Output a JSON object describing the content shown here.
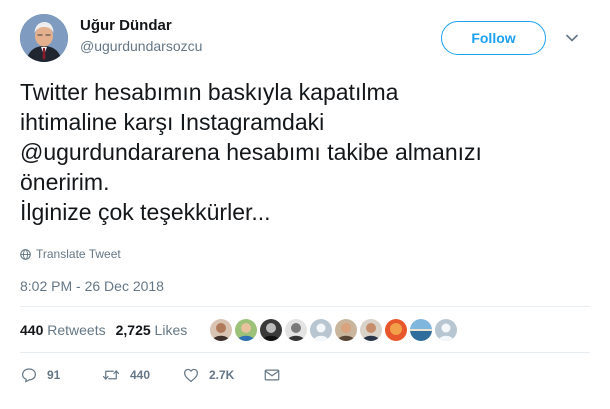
{
  "author": {
    "name": "Uğur Dündar",
    "handle": "@ugurdundarsozcu",
    "follow_label": "Follow"
  },
  "tweet": {
    "lines": [
      "Twitter hesabımın baskıyla kapatılma",
      "ihtimaline karşı Instagramdaki",
      "@ugurdundararena hesabımı takibe almanızı",
      "öneririm.",
      "İlginize çok teşekkürler..."
    ],
    "translate_label": "Translate Tweet",
    "timestamp": "8:02 PM - 26 Dec 2018"
  },
  "stats": {
    "retweets_count": "440",
    "retweets_label": "Retweets",
    "likes_count": "2,725",
    "likes_label": "Likes"
  },
  "actions": {
    "replies": "91",
    "retweets": "440",
    "likes": "2.7K"
  },
  "icons": [
    "caret-down-icon",
    "globe-icon",
    "reply-icon",
    "retweet-icon",
    "heart-icon",
    "mail-icon"
  ],
  "colors": {
    "accent": "#1da1f2",
    "text": "#14171a",
    "muted": "#657786",
    "divider": "#e6ecf0"
  }
}
